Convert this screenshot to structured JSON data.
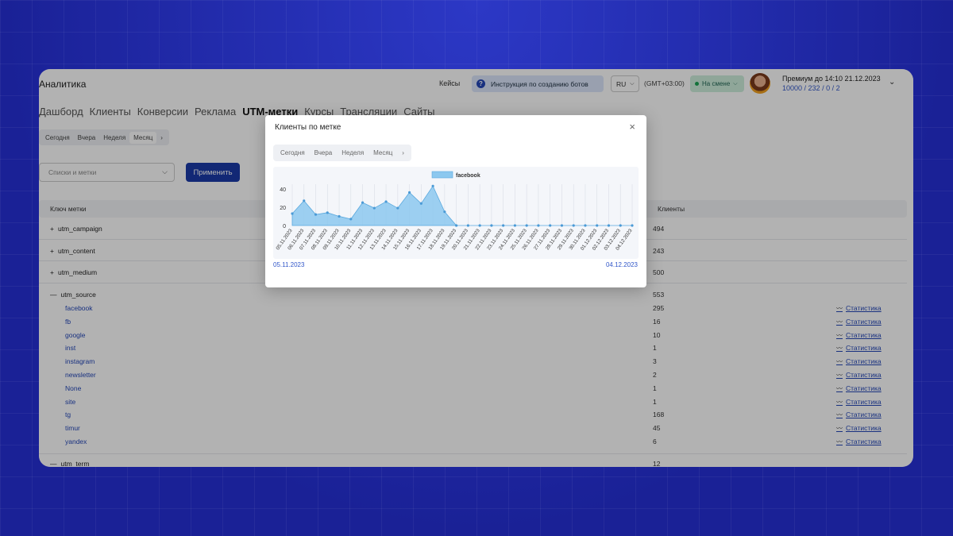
{
  "header": {
    "app_title": "Аналитика",
    "cases_link": "Кейсы",
    "guide_button": "Инструкция по созданию ботов",
    "language": "RU",
    "timezone": "(GMT+03:00)",
    "shift_status": "На смене",
    "premium_text": "Премиум до 14:10 21.12.2023",
    "limits": {
      "total": "10000",
      "used": "232",
      "a": "0",
      "b": "2"
    }
  },
  "nav": {
    "tabs": [
      "Дашборд",
      "Клиенты",
      "Конверсии",
      "Реклама",
      "UTM-метки",
      "Курсы",
      "Трансляции",
      "Сайты"
    ],
    "active": "UTM-метки"
  },
  "period": {
    "options": [
      "Сегодня",
      "Вчера",
      "Неделя",
      "Месяц"
    ],
    "selected": "Месяц",
    "more": "›"
  },
  "filters": {
    "placeholder": "Списки и метки",
    "apply_label": "Применить"
  },
  "table": {
    "col_key": "Ключ метки",
    "col_clients": "Клиенты",
    "stat_label": "Статистика",
    "rows": [
      {
        "name": "utm_campaign",
        "prefix": "+",
        "value": "494"
      },
      {
        "name": "utm_content",
        "prefix": "+",
        "value": "243"
      },
      {
        "name": "utm_medium",
        "prefix": "+",
        "value": "500"
      },
      {
        "name": "utm_source",
        "prefix": "—",
        "value": "553"
      }
    ],
    "source_children": [
      {
        "name": "facebook",
        "value": "295"
      },
      {
        "name": "fb",
        "value": "16"
      },
      {
        "name": "google",
        "value": "10"
      },
      {
        "name": "inst",
        "value": "1"
      },
      {
        "name": "instagram",
        "value": "3"
      },
      {
        "name": "newsletter",
        "value": "2"
      },
      {
        "name": "None",
        "value": "1"
      },
      {
        "name": "site",
        "value": "1"
      },
      {
        "name": "tg",
        "value": "168"
      },
      {
        "name": "timur",
        "value": "45"
      },
      {
        "name": "yandex",
        "value": "6"
      }
    ],
    "last_row": {
      "name": "utm_term",
      "prefix": "—",
      "value": "12"
    }
  },
  "modal": {
    "title": "Клиенты по метке",
    "close": "×",
    "period_options": [
      "Сегодня",
      "Вчера",
      "Неделя",
      "Месяц"
    ],
    "more": "›",
    "range_start": "05.11.2023",
    "range_end": "04.12.2023"
  },
  "chart_data": {
    "type": "area",
    "series": [
      {
        "name": "facebook",
        "values": [
          13,
          27,
          12,
          14,
          10,
          7,
          25,
          19,
          26,
          19,
          36,
          24,
          43,
          15,
          0,
          0,
          0,
          0,
          0,
          0,
          0,
          0,
          0,
          0,
          0,
          0,
          0,
          0,
          0,
          0
        ]
      }
    ],
    "x": [
      "05.11.2023",
      "06.11.2023",
      "07.11.2023",
      "08.11.2023",
      "09.11.2023",
      "10.11.2023",
      "11.11.2023",
      "12.11.2023",
      "13.11.2023",
      "14.11.2023",
      "15.11.2023",
      "16.11.2023",
      "17.11.2023",
      "18.11.2023",
      "19.11.2023",
      "20.11.2023",
      "21.11.2023",
      "22.11.2023",
      "23.11.2023",
      "24.11.2023",
      "25.11.2023",
      "26.11.2023",
      "27.11.2023",
      "28.11.2023",
      "29.11.2023",
      "30.11.2023",
      "01.12.2023",
      "02.12.2023",
      "03.12.2023",
      "04.12.2023"
    ],
    "yticks": [
      "0",
      "20",
      "40"
    ],
    "ylim": [
      0,
      45
    ],
    "legend": "top",
    "color": "#8cc8ef"
  }
}
